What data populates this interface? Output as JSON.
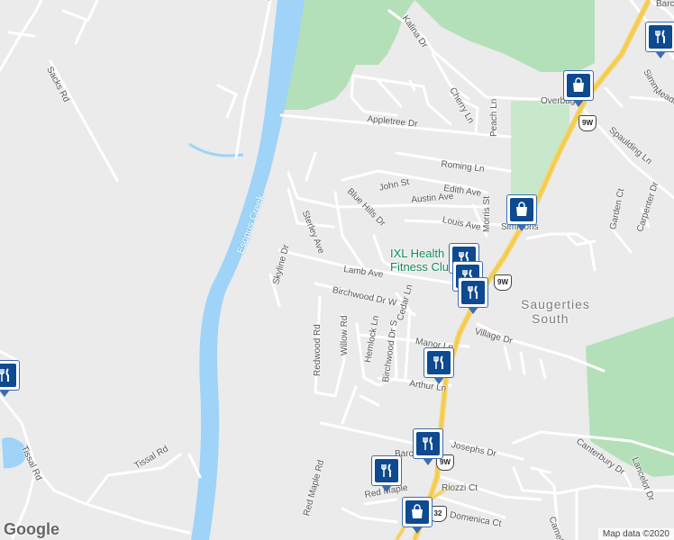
{
  "map": {
    "water_label": "Esopus Creek",
    "area_label_line1": "Saugerties",
    "area_label_line2": "South",
    "poi_label_line1": "IXL Health",
    "poi_label_line2": "Fitness Clu",
    "attribution": "Map data ©2020",
    "logo": "Google",
    "colors": {
      "land": "#ebebeb",
      "water": "#9fd3f7",
      "park": "#b3e0b8",
      "road": "#ffffff",
      "highway": "#f7d260",
      "pin": "#0d4a8f"
    }
  },
  "streets": [
    "Sacks Rd",
    "Kalina Dr",
    "Cherry Ln",
    "Peach Ln",
    "Overbag",
    "Appletree Dr",
    "Roming Ln",
    "John St",
    "Edith Ave",
    "Austin Ave",
    "Blue Hills Dr",
    "Morris St",
    "Louis Ave",
    "Sterley Ave",
    "Skyline Dr",
    "Lamb Ave",
    "Birchwood Dr W",
    "Cedar Ln",
    "Redwood Rd",
    "Willow Rd",
    "Hemlock Ln",
    "Birchwood Dr S",
    "Manor Ln",
    "Village Dr",
    "Arthur Ln",
    "Josephs Dr",
    "Canterbury Dr",
    "Lancelot Dr",
    "Spaulding Ln",
    "Garden Ct",
    "Carpenter Dr",
    "Meadow",
    "Simm",
    "Barcl",
    "Riozzi Ct",
    "Red Maple",
    "Domenica Ct",
    "Camelo",
    "Tissal Rd",
    "Es",
    "Simmons",
    "Red Maple Rd",
    "Barclay"
  ],
  "shields": [
    "9W",
    "9W",
    "9W",
    "32"
  ],
  "pins": [
    {
      "type": "shopping",
      "icon": "shopping-bag-icon"
    },
    {
      "type": "restaurant",
      "icon": "fork-knife-icon"
    },
    {
      "type": "shopping",
      "icon": "shopping-bag-icon"
    },
    {
      "type": "restaurant",
      "icon": "fork-knife-icon"
    },
    {
      "type": "restaurant",
      "icon": "fork-knife-icon"
    },
    {
      "type": "restaurant",
      "icon": "fork-knife-icon"
    },
    {
      "type": "restaurant",
      "icon": "fork-knife-icon"
    },
    {
      "type": "restaurant",
      "icon": "fork-knife-icon"
    },
    {
      "type": "restaurant",
      "icon": "fork-knife-icon"
    },
    {
      "type": "restaurant",
      "icon": "fork-knife-icon"
    },
    {
      "type": "shopping",
      "icon": "shopping-bag-icon"
    }
  ]
}
